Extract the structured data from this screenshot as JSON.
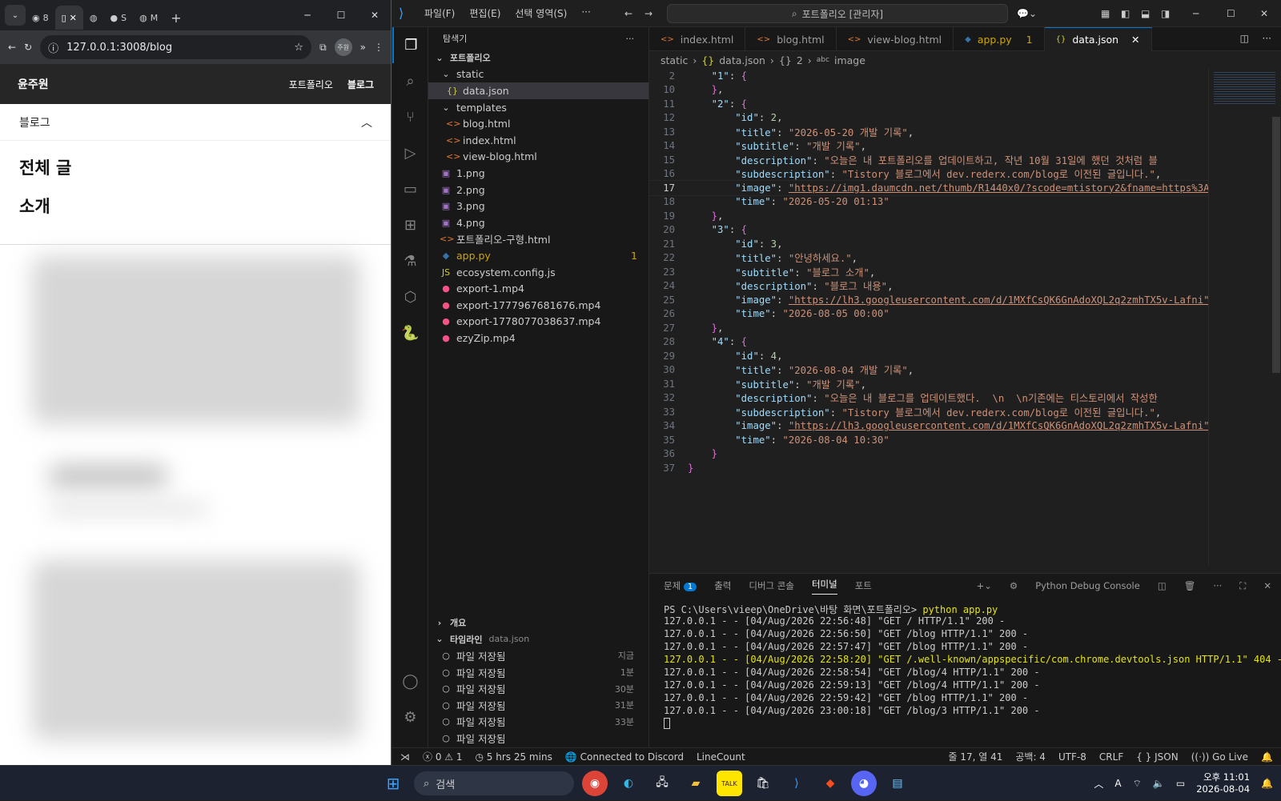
{
  "browser": {
    "tabs": [
      {
        "label": "8",
        "icon": "loading-icon"
      },
      {
        "label": "",
        "icon": "page-icon"
      },
      {
        "label": "",
        "icon": "globe-icon"
      },
      {
        "label": "S",
        "icon": "github-icon"
      },
      {
        "label": "M",
        "icon": "globe-icon"
      }
    ],
    "url": "127.0.0.1:3008/blog",
    "profile_label": "주원"
  },
  "site": {
    "brand": "윤주원",
    "nav": [
      "포트폴리오",
      "블로그"
    ],
    "menu_title": "블로그",
    "menu_items": [
      "전체 글",
      "소개"
    ]
  },
  "vscode": {
    "menu": [
      "파일(F)",
      "편집(E)",
      "선택 영역(S)",
      "···"
    ],
    "command_center": "포트폴리오 [관리자]",
    "explorer_title": "탐색기",
    "root_folder": "포트폴리오",
    "tree": [
      {
        "label": "static",
        "type": "folder",
        "depth": 1
      },
      {
        "label": "data.json",
        "type": "json",
        "depth": 2,
        "selected": true
      },
      {
        "label": "templates",
        "type": "folder",
        "depth": 1
      },
      {
        "label": "blog.html",
        "type": "html",
        "depth": 2
      },
      {
        "label": "index.html",
        "type": "html",
        "depth": 2
      },
      {
        "label": "view-blog.html",
        "type": "html",
        "depth": 2
      },
      {
        "label": "1.png",
        "type": "image",
        "depth": 1
      },
      {
        "label": "2.png",
        "type": "image",
        "depth": 1
      },
      {
        "label": "3.png",
        "type": "image",
        "depth": 1
      },
      {
        "label": "4.png",
        "type": "image",
        "depth": 1
      },
      {
        "label": "포트폴리오-구형.html",
        "type": "html",
        "depth": 1
      },
      {
        "label": "app.py",
        "type": "python",
        "depth": 1,
        "badge": "1"
      },
      {
        "label": "ecosystem.config.js",
        "type": "js",
        "depth": 1
      },
      {
        "label": "export-1.mp4",
        "type": "video",
        "depth": 1
      },
      {
        "label": "export-1777967681676.mp4",
        "type": "video",
        "depth": 1
      },
      {
        "label": "export-1778077038637.mp4",
        "type": "video",
        "depth": 1
      },
      {
        "label": "ezyZip.mp4",
        "type": "video",
        "depth": 1
      }
    ],
    "outline_title": "개요",
    "timeline_title": "타임라인",
    "timeline_file": "data.json",
    "timeline": [
      {
        "label": "파일 저장됨",
        "time": "지금"
      },
      {
        "label": "파일 저장됨",
        "time": "1분"
      },
      {
        "label": "파일 저장됨",
        "time": "30분"
      },
      {
        "label": "파일 저장됨",
        "time": "31분"
      },
      {
        "label": "파일 저장됨",
        "time": "33분"
      },
      {
        "label": "파일 저장됨",
        "time": ""
      }
    ],
    "editor_tabs": [
      {
        "label": "index.html",
        "type": "html"
      },
      {
        "label": "blog.html",
        "type": "html"
      },
      {
        "label": "view-blog.html",
        "type": "html"
      },
      {
        "label": "app.py",
        "type": "python",
        "badge": "1"
      },
      {
        "label": "data.json",
        "type": "json",
        "active": true
      }
    ],
    "breadcrumb": [
      "static",
      "data.json",
      "2",
      "image"
    ],
    "code_lines": [
      {
        "n": "2",
        "text": "    \"1\": {"
      },
      {
        "n": "10",
        "text": "    },"
      },
      {
        "n": "11",
        "text": "    \"2\": {"
      },
      {
        "n": "12",
        "text": "        \"id\": 2,"
      },
      {
        "n": "13",
        "text": "        \"title\": \"2026-05-20 개발 기록\","
      },
      {
        "n": "14",
        "text": "        \"subtitle\": \"개발 기록\","
      },
      {
        "n": "15",
        "text": "        \"description\": \"오늘은 내 포트폴리오를 업데이트하고, 작년 10월 31일에 했던 것처럼 블"
      },
      {
        "n": "16",
        "text": "        \"subdescription\": \"Tistory 블로그에서 dev.rederx.com/blog로 이전된 글입니다.\","
      },
      {
        "n": "17",
        "text": "        \"image\": \"https://img1.daumcdn.net/thumb/R1440x0/?scode=mtistory2&fname=https%3A%"
      },
      {
        "n": "18",
        "text": "        \"time\": \"2026-05-20 01:13\""
      },
      {
        "n": "19",
        "text": "    },"
      },
      {
        "n": "20",
        "text": "    \"3\": {"
      },
      {
        "n": "21",
        "text": "        \"id\": 3,"
      },
      {
        "n": "22",
        "text": "        \"title\": \"안녕하세요.\","
      },
      {
        "n": "23",
        "text": "        \"subtitle\": \"블로그 소개\","
      },
      {
        "n": "24",
        "text": "        \"description\": \"블로그 내용\","
      },
      {
        "n": "25",
        "text": "        \"image\": \"https://lh3.googleusercontent.com/d/1MXfCsQK6GnAdoXQL2q2zmhTX5v-Lafni\","
      },
      {
        "n": "26",
        "text": "        \"time\": \"2026-08-05 00:00\""
      },
      {
        "n": "27",
        "text": "    },"
      },
      {
        "n": "28",
        "text": "    \"4\": {"
      },
      {
        "n": "29",
        "text": "        \"id\": 4,"
      },
      {
        "n": "30",
        "text": "        \"title\": \"2026-08-04 개발 기록\","
      },
      {
        "n": "31",
        "text": "        \"subtitle\": \"개발 기록\","
      },
      {
        "n": "32",
        "text": "        \"description\": \"오늘은 내 블로그를 업데이트했다.  \\n  \\n기존에는 티스토리에서 작성한"
      },
      {
        "n": "33",
        "text": "        \"subdescription\": \"Tistory 블로그에서 dev.rederx.com/blog로 이전된 글입니다.\","
      },
      {
        "n": "34",
        "text": "        \"image\": \"https://lh3.googleusercontent.com/d/1MXfCsQK6GnAdoXQL2q2zmhTX5v-Lafni\","
      },
      {
        "n": "35",
        "text": "        \"time\": \"2026-08-04 10:30\""
      },
      {
        "n": "36",
        "text": "    }"
      },
      {
        "n": "37",
        "text": "}"
      }
    ],
    "current_line": "17",
    "panel_tabs": [
      "문제",
      "출력",
      "디버그 콘솔",
      "터미널",
      "포트"
    ],
    "problems_count": "1",
    "panel_session": "Python Debug Console",
    "terminal_prompt": "PS C:\\Users\\vieep\\OneDrive\\바탕 화면\\포트폴리오>",
    "terminal_command": "python app.py",
    "terminal_lines": [
      "127.0.0.1 - - [04/Aug/2026 22:56:48] \"GET / HTTP/1.1\" 200 -",
      "127.0.0.1 - - [04/Aug/2026 22:56:50] \"GET /blog HTTP/1.1\" 200 -",
      "127.0.0.1 - - [04/Aug/2026 22:57:47] \"GET /blog HTTP/1.1\" 200 -",
      "127.0.0.1 - - [04/Aug/2026 22:58:20] \"GET /.well-known/appspecific/com.chrome.devtools.json HTTP/1.1\" 404 -",
      "127.0.0.1 - - [04/Aug/2026 22:58:54] \"GET /blog/4 HTTP/1.1\" 200 -",
      "127.0.0.1 - - [04/Aug/2026 22:59:13] \"GET /blog/4 HTTP/1.1\" 200 -",
      "127.0.0.1 - - [04/Aug/2026 22:59:42] \"GET /blog HTTP/1.1\" 200 -",
      "127.0.0.1 - - [04/Aug/2026 23:00:18] \"GET /blog/3 HTTP/1.1\" 200 -"
    ],
    "status": {
      "errors": "0",
      "warnings": "1",
      "time_tracker": "5 hrs 25 mins",
      "discord": "Connected to Discord",
      "linecount": "LineCount",
      "position": "줄 17, 열 41",
      "indent": "공백: 4",
      "encoding": "UTF-8",
      "eol": "CRLF",
      "language": "JSON",
      "golive": "Go Live"
    }
  },
  "taskbar": {
    "search_placeholder": "검색",
    "time_ampm": "오후 11:01",
    "date": "2026-08-04"
  }
}
